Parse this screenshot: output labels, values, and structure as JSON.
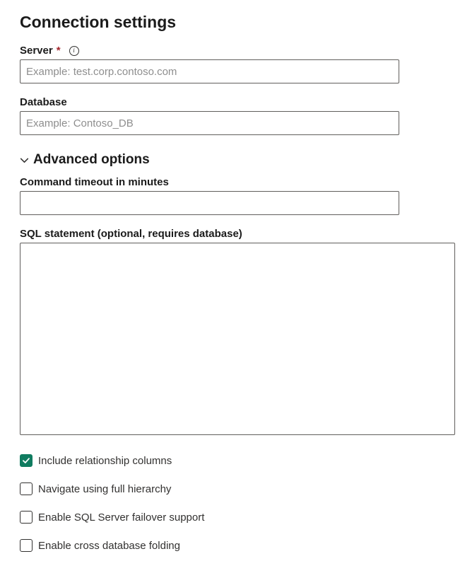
{
  "heading": "Connection settings",
  "server": {
    "label": "Server",
    "required_marker": "*",
    "placeholder": "Example: test.corp.contoso.com",
    "value": ""
  },
  "database": {
    "label": "Database",
    "placeholder": "Example: Contoso_DB",
    "value": ""
  },
  "advanced": {
    "title": "Advanced options",
    "command_timeout": {
      "label": "Command timeout in minutes",
      "value": ""
    },
    "sql_statement": {
      "label": "SQL statement (optional, requires database)",
      "value": ""
    },
    "checkboxes": [
      {
        "label": "Include relationship columns",
        "checked": true
      },
      {
        "label": "Navigate using full hierarchy",
        "checked": false
      },
      {
        "label": "Enable SQL Server failover support",
        "checked": false
      },
      {
        "label": "Enable cross database folding",
        "checked": false
      }
    ]
  }
}
